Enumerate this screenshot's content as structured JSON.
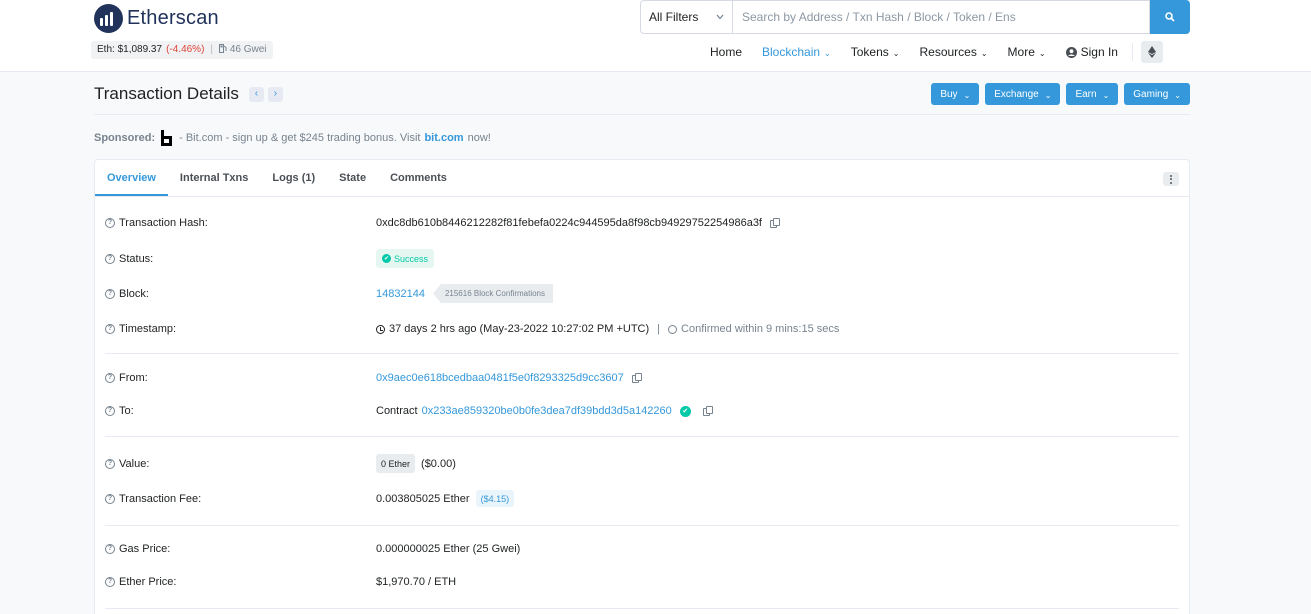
{
  "brand": {
    "name": "Etherscan"
  },
  "ticker": {
    "eth_price": "Eth: $1,089.37",
    "change": "(-4.46%)",
    "separator": "|",
    "gas": "46 Gwei"
  },
  "search": {
    "filter": "All Filters",
    "placeholder": "Search by Address / Txn Hash / Block / Token / Ens"
  },
  "nav": {
    "home": "Home",
    "blockchain": "Blockchain",
    "tokens": "Tokens",
    "resources": "Resources",
    "more": "More",
    "sign_in": "Sign In"
  },
  "page": {
    "title": "Transaction Details",
    "actions": {
      "buy": "Buy",
      "exchange": "Exchange",
      "earn": "Earn",
      "gaming": "Gaming"
    }
  },
  "sponsored": {
    "label": "Sponsored:",
    "text": "- Bit.com - sign up & get $245 trading bonus. Visit",
    "link": "bit.com",
    "suffix": "now!"
  },
  "tabs": [
    "Overview",
    "Internal Txns",
    "Logs (1)",
    "State",
    "Comments"
  ],
  "details": {
    "hash": {
      "label": "Transaction Hash:",
      "value": "0xdc8db610b8446212282f81febefa0224c944595da8f98cb94929752254986a3f"
    },
    "status": {
      "label": "Status:",
      "value": "Success"
    },
    "block": {
      "label": "Block:",
      "value": "14832144",
      "confirmations": "215616 Block Confirmations"
    },
    "timestamp": {
      "label": "Timestamp:",
      "value": "37 days 2 hrs ago (May-23-2022 10:27:02 PM +UTC)",
      "separator": "|",
      "confirmed": "Confirmed within 9 mins:15 secs"
    },
    "from": {
      "label": "From:",
      "value": "0x9aec0e618bcedbaa0481f5e0f8293325d9cc3607"
    },
    "to": {
      "label": "To:",
      "prefix": "Contract",
      "value": "0x233ae859320be0b0fe3dea7df39bdd3d5a142260"
    },
    "value": {
      "label": "Value:",
      "ether": "0 Ether",
      "usd": "($0.00)"
    },
    "fee": {
      "label": "Transaction Fee:",
      "ether": "0.003805025 Ether",
      "usd": "($4.15)"
    },
    "gas_price": {
      "label": "Gas Price:",
      "value": "0.000000025 Ether (25 Gwei)"
    },
    "ether_price": {
      "label": "Ether Price:",
      "value": "$1,970.70 / ETH"
    }
  },
  "colors": {
    "accent": "#3498db",
    "success": "#00c9a7",
    "brand": "#21325b"
  }
}
